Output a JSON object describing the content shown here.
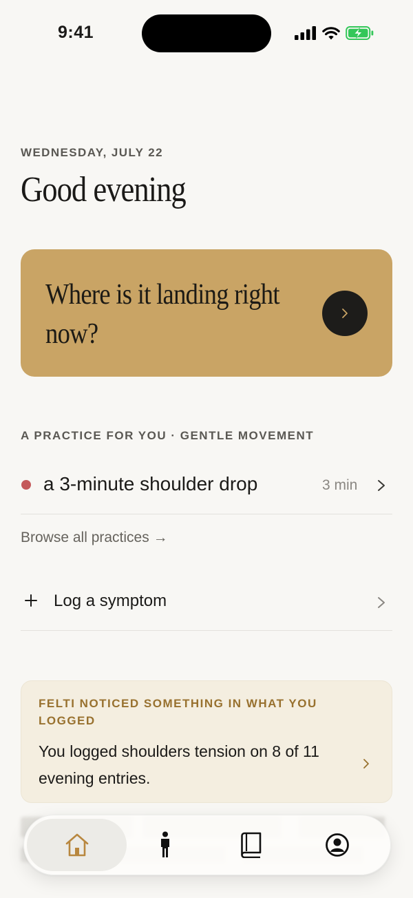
{
  "status_bar": {
    "time": "9:41"
  },
  "header": {
    "date": "WEDNESDAY, JULY 22",
    "greeting": "Good evening"
  },
  "checkin": {
    "prompt": "Where is it landing right now?"
  },
  "practice": {
    "section_label": "A PRACTICE FOR YOU · GENTLE MOVEMENT",
    "title": "a 3-minute shoulder drop",
    "duration": "3 min",
    "browse_link": "Browse all practices →"
  },
  "log": {
    "label": "Log a symptom"
  },
  "insight": {
    "label": "FELTI NOTICED SOMETHING IN WHAT YOU LOGGED",
    "text": "You logged shoulders tension on 8 of 11 evening entries."
  },
  "colors": {
    "background": "#f8f7f4",
    "accent_gold": "#c9a465",
    "insight_bg": "#f4eee0",
    "insight_label": "#98712f",
    "practice_dot": "#c4595a",
    "active_tab_icon": "#b8873f"
  },
  "tab_bar": {
    "active": "home",
    "tabs": [
      {
        "id": "home",
        "icon": "home-icon"
      },
      {
        "id": "body",
        "icon": "person-icon"
      },
      {
        "id": "library",
        "icon": "book-icon"
      },
      {
        "id": "profile",
        "icon": "profile-icon"
      }
    ]
  }
}
